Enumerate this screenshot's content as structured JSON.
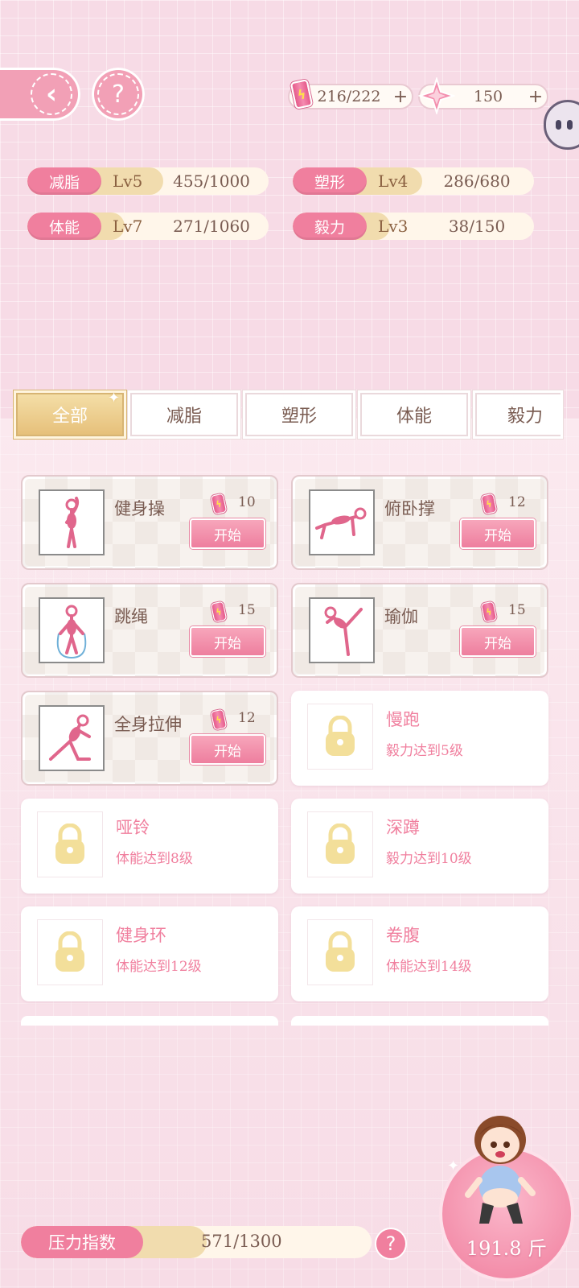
{
  "currencies": {
    "energy": "216/222",
    "stars": "150",
    "plus": "+"
  },
  "stats": [
    {
      "name": "减脂",
      "level": "Lv5",
      "progress": "455/1000",
      "ratio": 0.455
    },
    {
      "name": "塑形",
      "level": "Lv4",
      "progress": "286/680",
      "ratio": 0.42
    },
    {
      "name": "体能",
      "level": "Lv7",
      "progress": "271/1060",
      "ratio": 0.256
    },
    {
      "name": "毅力",
      "level": "Lv3",
      "progress": "38/150",
      "ratio": 0.253
    }
  ],
  "tabs": [
    "全部",
    "减脂",
    "塑形",
    "体能",
    "毅力"
  ],
  "exercises": [
    {
      "name": "健身操",
      "cost": "10",
      "button": "开始"
    },
    {
      "name": "俯卧撑",
      "cost": "12",
      "button": "开始"
    },
    {
      "name": "跳绳",
      "cost": "15",
      "button": "开始"
    },
    {
      "name": "瑜伽",
      "cost": "15",
      "button": "开始"
    },
    {
      "name": "全身拉伸",
      "cost": "12",
      "button": "开始"
    }
  ],
  "locked": [
    {
      "name": "慢跑",
      "requirement": "毅力达到5级"
    },
    {
      "name": "哑铃",
      "requirement": "体能达到8级"
    },
    {
      "name": "深蹲",
      "requirement": "毅力达到10级"
    },
    {
      "name": "健身环",
      "requirement": "体能达到12级"
    },
    {
      "name": "卷腹",
      "requirement": "体能达到14级"
    }
  ],
  "stress": {
    "label": "压力指数",
    "value": "571/1300",
    "ratio": 0.44
  },
  "weight": "191.8 斤",
  "colors": {
    "accent": "#f07f9e",
    "gold": "#e6c07a",
    "background": "#f7dbe6"
  }
}
